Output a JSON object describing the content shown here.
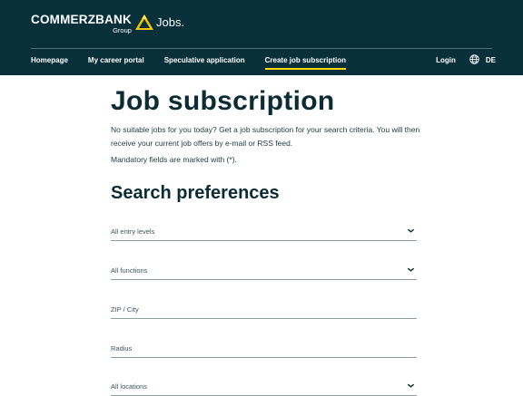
{
  "header": {
    "brand_name": "COMMERZBANK",
    "brand_sub": "Group",
    "section": "Jobs.",
    "nav": [
      {
        "label": "Homepage"
      },
      {
        "label": "My career portal"
      },
      {
        "label": "Speculative application"
      },
      {
        "label": "Create job subscription",
        "active": true
      }
    ],
    "login": "Login",
    "language": "DE",
    "colors": {
      "background": "#08303a",
      "accent": "#ffd600"
    }
  },
  "main": {
    "title": "Job subscription",
    "intro": "No suitable jobs for you today? Get a job subscription for your search criteria. You will then receive your current job offers by e-mail or RSS feed.",
    "mandatory": "Mandatory fields are marked with (*).",
    "section_title": "Search preferences",
    "fields": [
      {
        "label": "All entry levels",
        "type": "select"
      },
      {
        "label": "All functions",
        "type": "select"
      },
      {
        "label": "ZIP / City",
        "type": "text"
      },
      {
        "label": "Radius",
        "type": "text"
      },
      {
        "label": "All locations",
        "type": "select"
      }
    ]
  }
}
